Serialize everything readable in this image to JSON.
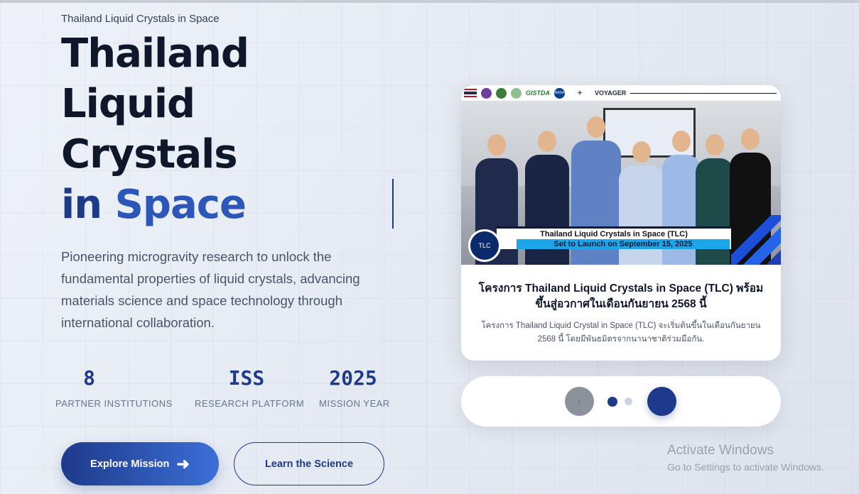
{
  "hero": {
    "eyebrow": "Thailand Liquid Crystals in Space",
    "title_line1": "Thailand",
    "title_line2": "Liquid",
    "title_line3": "Crystals",
    "title_in": "in",
    "title_space": "Space",
    "description": "Pioneering microgravity research to unlock the fundamental properties of liquid crystals, advancing materials science and space technology through international collaboration."
  },
  "stats": [
    {
      "value": "8",
      "label": "PARTNER INSTITUTIONS"
    },
    {
      "value": "ISS",
      "label": "RESEARCH PLATFORM"
    },
    {
      "value": "2025",
      "label": "MISSION YEAR"
    }
  ],
  "buttons": {
    "primary": "Explore Mission",
    "primary_icon": "arrow-right-icon",
    "secondary": "Learn the Science"
  },
  "card": {
    "logos": [
      "GISTDA",
      "NASA",
      "VOYAGER"
    ],
    "banner_line1": "Thailand Liquid Crystals in Space (TLC)",
    "banner_line2": "Set to Launch on September 15, 2025",
    "badge_text": "TLC",
    "title": "โครงการ Thailand Liquid Crystals in Space (TLC) พร้อมขึ้นสู่อวกาศในเดือนกันยายน 2568 นี้",
    "subtitle": "โครงการ Thailand Liquid Crystal in Space (TLC) จะเริ่มต้นขึ้นในเดือนกันยายน 2568 นี้ โดยมีพันธมิตรจากนานาชาติร่วมมือกัน."
  },
  "carousel": {
    "prev_icon": "chevron-left-icon",
    "next_icon": "chevron-right-icon",
    "prev_glyph": "‹",
    "next_glyph": "›",
    "active_index": 0,
    "total": 2
  },
  "os_watermark": {
    "line1": "Activate Windows",
    "line2": "Go to Settings to activate Windows."
  },
  "colors": {
    "navy": "#1e3a8a",
    "accent_blue": "#2c56b8",
    "text_dark": "#0f172a",
    "text_muted": "#475569"
  }
}
